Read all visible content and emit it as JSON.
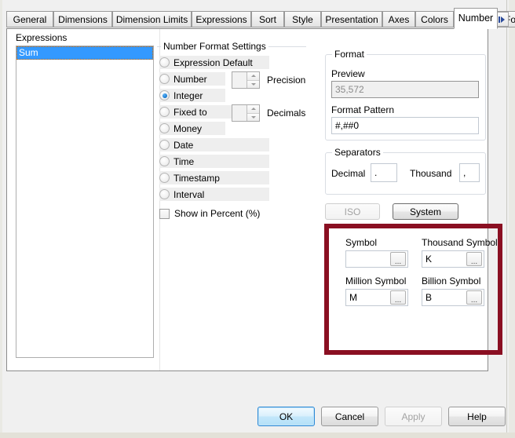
{
  "window": {
    "tabs": [
      {
        "label": "General",
        "active": false
      },
      {
        "label": "Dimensions",
        "active": false
      },
      {
        "label": "Dimension Limits",
        "active": false
      },
      {
        "label": "Expressions",
        "active": false
      },
      {
        "label": "Sort",
        "active": false
      },
      {
        "label": "Style",
        "active": false
      },
      {
        "label": "Presentation",
        "active": false
      },
      {
        "label": "Axes",
        "active": false
      },
      {
        "label": "Colors",
        "active": false
      },
      {
        "label": "Number",
        "active": true
      },
      {
        "label": "Font",
        "active": false
      }
    ],
    "tab_scroll_left_icon": "scroll-left-icon",
    "tab_scroll_right_icon": "scroll-right-icon"
  },
  "expressions": {
    "label": "Expressions",
    "items": [
      {
        "label": "Sum",
        "selected": true
      }
    ]
  },
  "number_format": {
    "group_title": "Number Format Settings",
    "options": [
      {
        "label": "Expression Default",
        "selected": false
      },
      {
        "label": "Number",
        "selected": false
      },
      {
        "label": "Integer",
        "selected": true
      },
      {
        "label": "Fixed to",
        "selected": false
      },
      {
        "label": "Money",
        "selected": false
      },
      {
        "label": "Date",
        "selected": false
      },
      {
        "label": "Time",
        "selected": false
      },
      {
        "label": "Timestamp",
        "selected": false
      },
      {
        "label": "Interval",
        "selected": false
      }
    ],
    "precision_caption": "Precision",
    "precision_value": "",
    "decimals_caption": "Decimals",
    "decimals_value": "",
    "show_in_percent": {
      "label": "Show in Percent (%)",
      "checked": false
    }
  },
  "format": {
    "group_title": "Format",
    "preview_label": "Preview",
    "preview_value": "35,572",
    "pattern_label": "Format Pattern",
    "pattern_value": "#,##0"
  },
  "separators": {
    "group_title": "Separators",
    "decimal_label": "Decimal",
    "decimal_value": ".",
    "thousand_label": "Thousand",
    "thousand_value": ","
  },
  "standard_buttons": {
    "iso_label": "ISO",
    "iso_enabled": false,
    "system_label": "System",
    "system_enabled": true
  },
  "symbols": {
    "symbol_label": "Symbol",
    "symbol_value": "",
    "thousand_symbol_label": "Thousand Symbol",
    "thousand_symbol_value": "K",
    "million_symbol_label": "Million Symbol",
    "million_symbol_value": "M",
    "billion_symbol_label": "Billion Symbol",
    "billion_symbol_value": "B",
    "ellipsis_label": "...",
    "highlight_color": "#8a0f22"
  },
  "dialog_buttons": {
    "ok": "OK",
    "cancel": "Cancel",
    "apply": "Apply",
    "help": "Help"
  }
}
